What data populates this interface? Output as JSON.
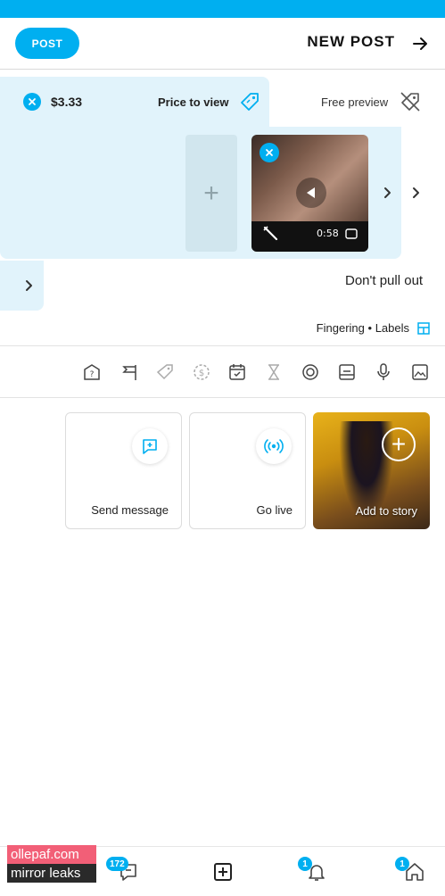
{
  "header": {
    "post_label": "POST",
    "title": "NEW POST"
  },
  "pricing": {
    "price_value": "$3.33",
    "price_label": "Price to view",
    "free_label": "Free preview"
  },
  "media": {
    "add_symbol": "+",
    "duration": "0:58"
  },
  "caption": "Don't pull out",
  "labels": {
    "title": "Labels",
    "items": "Fingering",
    "separator": "•"
  },
  "actions": {
    "send_message": "Send message",
    "go_live": "Go live",
    "add_to_story": "Add to story"
  },
  "nav": {
    "messages_badge": "172",
    "notifications_badge": "1",
    "home_badge": "1"
  },
  "watermark": {
    "line1": "ollepaf.com",
    "line2": "mirror leaks"
  },
  "colors": {
    "accent": "#00aff0",
    "tint": "#e1f3fb"
  },
  "icons": [
    "back-arrow-icon",
    "price-tag-icon",
    "free-preview-icon",
    "play-icon",
    "edit-icon",
    "labels-icon",
    "image-icon",
    "mic-icon",
    "gallery-icon",
    "poll-icon",
    "timer-icon",
    "schedule-icon",
    "dollar-icon",
    "tag-icon",
    "flag-icon",
    "question-icon",
    "send-message-icon",
    "live-icon",
    "home-icon",
    "bell-icon",
    "add-icon",
    "chat-icon"
  ]
}
